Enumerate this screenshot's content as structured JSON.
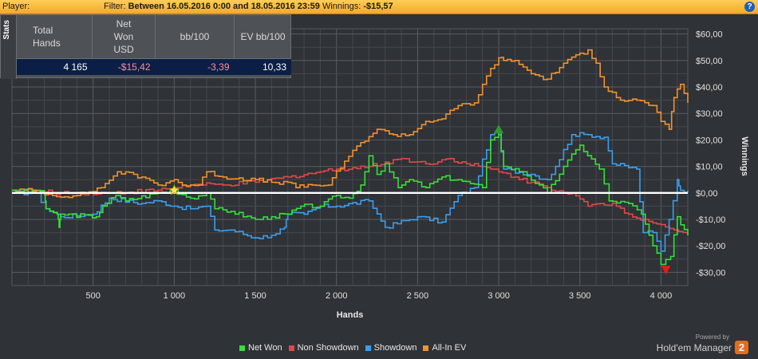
{
  "topbar": {
    "player_label": "Player:",
    "filter_label": "Filter:",
    "filter_value": "Between 16.05.2016 0:00 and 18.05.2016 23:59",
    "winnings_label": "Winnings:",
    "winnings_value": "-$15,57",
    "help_icon": "?"
  },
  "stats": {
    "tab_label": "Stats",
    "headers": [
      "Total\nHands",
      "Net\nWon\nUSD",
      "bb/100",
      "EV bb/100"
    ],
    "values": [
      "4 165",
      "-$15,42",
      "-3,39",
      "10,33"
    ]
  },
  "legend": [
    {
      "label": "Net Won",
      "color": "#35e03a"
    },
    {
      "label": "Non Showdown",
      "color": "#e04848"
    },
    {
      "label": "Showdown",
      "color": "#3a9ef0"
    },
    {
      "label": "All-In EV",
      "color": "#f4912c"
    }
  ],
  "brand": {
    "powered_by": "Powered by",
    "name": "Hold'em Manager",
    "logo": "2"
  },
  "chart_data": {
    "type": "line",
    "xlabel": "Hands",
    "ylabel": "Winnings",
    "xlim": [
      0,
      4165
    ],
    "ylim": [
      -35,
      62
    ],
    "x_ticks": [
      500,
      1000,
      1500,
      2000,
      2500,
      3000,
      3500,
      4000
    ],
    "x_tick_labels": [
      "500",
      "1 000",
      "1 500",
      "2 000",
      "2 500",
      "3 000",
      "3 500",
      "4 000"
    ],
    "y_ticks": [
      -30,
      -20,
      -10,
      0,
      10,
      20,
      30,
      40,
      50,
      60
    ],
    "y_tick_labels": [
      "-$30,00",
      "-$20,00",
      "-$10,00",
      "$0,00",
      "$10,00",
      "$20,00",
      "$30,00",
      "$40,00",
      "$50,00",
      "$60,00"
    ],
    "grid": true,
    "series": [
      {
        "name": "Net Won",
        "color": "#35e03a",
        "points": [
          [
            0,
            1
          ],
          [
            200,
            0
          ],
          [
            210,
            -6
          ],
          [
            280,
            -8
          ],
          [
            290,
            -13
          ],
          [
            300,
            -8
          ],
          [
            520,
            -9
          ],
          [
            560,
            -5
          ],
          [
            640,
            -1
          ],
          [
            700,
            -3
          ],
          [
            900,
            0
          ],
          [
            1000,
            1
          ],
          [
            1100,
            -2
          ],
          [
            1200,
            0
          ],
          [
            1250,
            -6
          ],
          [
            1350,
            -7
          ],
          [
            1500,
            -10
          ],
          [
            1600,
            -9
          ],
          [
            1700,
            -8
          ],
          [
            1780,
            -5
          ],
          [
            1900,
            -5
          ],
          [
            2000,
            -1
          ],
          [
            2080,
            -2
          ],
          [
            2150,
            3
          ],
          [
            2200,
            14
          ],
          [
            2250,
            7
          ],
          [
            2300,
            11
          ],
          [
            2380,
            2
          ],
          [
            2450,
            5
          ],
          [
            2550,
            2
          ],
          [
            2650,
            6
          ],
          [
            2750,
            5
          ],
          [
            2900,
            2
          ],
          [
            2950,
            20
          ],
          [
            3000,
            23
          ],
          [
            3030,
            10
          ],
          [
            3150,
            8
          ],
          [
            3300,
            0
          ],
          [
            3400,
            10
          ],
          [
            3500,
            18
          ],
          [
            3620,
            9
          ],
          [
            3680,
            -3
          ],
          [
            3800,
            -4
          ],
          [
            3880,
            -8
          ],
          [
            3950,
            -20
          ],
          [
            4000,
            -27
          ],
          [
            4060,
            -24
          ],
          [
            4100,
            -9
          ],
          [
            4165,
            -16
          ]
        ]
      },
      {
        "name": "Non Showdown",
        "color": "#e04848",
        "points": [
          [
            0,
            1
          ],
          [
            300,
            0
          ],
          [
            600,
            0
          ],
          [
            900,
            1
          ],
          [
            1100,
            3
          ],
          [
            1300,
            3
          ],
          [
            1500,
            4
          ],
          [
            1700,
            6
          ],
          [
            1900,
            8
          ],
          [
            2000,
            9
          ],
          [
            2200,
            10
          ],
          [
            2400,
            13
          ],
          [
            2550,
            11
          ],
          [
            2700,
            13
          ],
          [
            2800,
            11
          ],
          [
            2950,
            9
          ],
          [
            3100,
            6
          ],
          [
            3200,
            4
          ],
          [
            3300,
            2
          ],
          [
            3450,
            0
          ],
          [
            3550,
            -5
          ],
          [
            3700,
            -4
          ],
          [
            3800,
            -8
          ],
          [
            3900,
            -10
          ],
          [
            4000,
            -12
          ],
          [
            4080,
            -14
          ],
          [
            4165,
            -16
          ]
        ]
      },
      {
        "name": "Showdown",
        "color": "#3a9ef0",
        "points": [
          [
            0,
            0
          ],
          [
            150,
            0
          ],
          [
            210,
            -6
          ],
          [
            300,
            -9
          ],
          [
            500,
            -8
          ],
          [
            600,
            -2
          ],
          [
            800,
            -4
          ],
          [
            900,
            -3
          ],
          [
            1000,
            -5
          ],
          [
            1100,
            -6
          ],
          [
            1200,
            -5
          ],
          [
            1250,
            -14
          ],
          [
            1350,
            -14
          ],
          [
            1500,
            -17
          ],
          [
            1600,
            -16
          ],
          [
            1680,
            -13
          ],
          [
            1700,
            -8
          ],
          [
            1800,
            -8
          ],
          [
            1900,
            -5
          ],
          [
            2000,
            -5
          ],
          [
            2200,
            -3
          ],
          [
            2300,
            -13
          ],
          [
            2500,
            -9
          ],
          [
            2650,
            -11
          ],
          [
            2750,
            -1
          ],
          [
            2850,
            2
          ],
          [
            2950,
            22
          ],
          [
            3000,
            22
          ],
          [
            3030,
            9
          ],
          [
            3200,
            7
          ],
          [
            3300,
            5
          ],
          [
            3350,
            10
          ],
          [
            3450,
            22
          ],
          [
            3550,
            22
          ],
          [
            3650,
            21
          ],
          [
            3700,
            11
          ],
          [
            3850,
            9
          ],
          [
            3890,
            -15
          ],
          [
            3950,
            -15
          ],
          [
            4000,
            -22
          ],
          [
            4050,
            -10
          ],
          [
            4100,
            5
          ],
          [
            4120,
            1
          ],
          [
            4165,
            1
          ]
        ]
      },
      {
        "name": "All-In EV",
        "color": "#f4912c",
        "points": [
          [
            0,
            1
          ],
          [
            150,
            1
          ],
          [
            250,
            -1
          ],
          [
            400,
            -1
          ],
          [
            550,
            2
          ],
          [
            650,
            8
          ],
          [
            800,
            6
          ],
          [
            900,
            3
          ],
          [
            1000,
            5
          ],
          [
            1050,
            3
          ],
          [
            1150,
            3
          ],
          [
            1200,
            8
          ],
          [
            1300,
            6
          ],
          [
            1500,
            5
          ],
          [
            1600,
            4
          ],
          [
            1700,
            4
          ],
          [
            1750,
            2
          ],
          [
            1850,
            3
          ],
          [
            1950,
            3
          ],
          [
            2050,
            12
          ],
          [
            2150,
            19
          ],
          [
            2250,
            24
          ],
          [
            2350,
            22
          ],
          [
            2450,
            22
          ],
          [
            2550,
            27
          ],
          [
            2650,
            28
          ],
          [
            2750,
            33
          ],
          [
            2850,
            34
          ],
          [
            2950,
            47
          ],
          [
            3000,
            51
          ],
          [
            3030,
            50
          ],
          [
            3100,
            50
          ],
          [
            3200,
            45
          ],
          [
            3300,
            43
          ],
          [
            3400,
            49
          ],
          [
            3550,
            54
          ],
          [
            3600,
            49
          ],
          [
            3650,
            40
          ],
          [
            3700,
            38
          ],
          [
            3750,
            35
          ],
          [
            3850,
            35
          ],
          [
            3950,
            33
          ],
          [
            4000,
            27
          ],
          [
            4050,
            24
          ],
          [
            4080,
            36
          ],
          [
            4120,
            41
          ],
          [
            4165,
            34
          ]
        ]
      }
    ],
    "markers": [
      {
        "type": "star",
        "x": 1000,
        "y": 1,
        "color": "#f6e84a"
      },
      {
        "type": "up-triangle",
        "x": 3000,
        "y": 24,
        "color": "#2e9a2e"
      },
      {
        "type": "down-triangle",
        "x": 4030,
        "y": -29,
        "color": "#e81818"
      }
    ]
  }
}
